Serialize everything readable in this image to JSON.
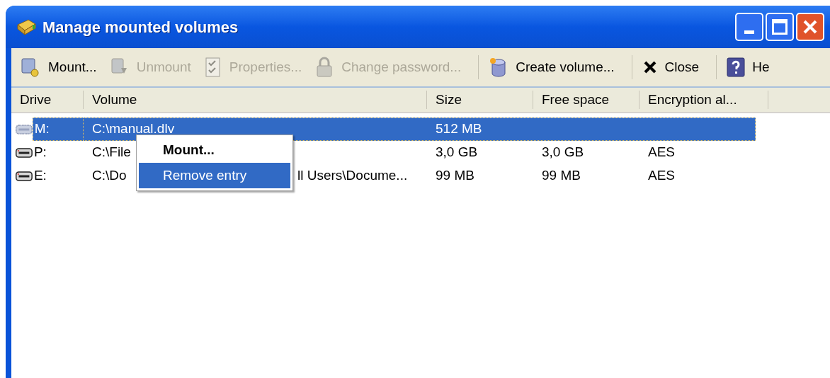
{
  "window": {
    "title": "Manage mounted volumes"
  },
  "toolbar": [
    {
      "kind": "mount",
      "label": "Mount...",
      "disabled": false
    },
    {
      "kind": "unmount",
      "label": "Unmount",
      "disabled": true
    },
    {
      "kind": "properties",
      "label": "Properties...",
      "disabled": true
    },
    {
      "kind": "password",
      "label": "Change password...",
      "disabled": true
    },
    {
      "kind": "separator"
    },
    {
      "kind": "create",
      "label": "Create volume...",
      "disabled": false
    },
    {
      "kind": "separator"
    },
    {
      "kind": "close",
      "label": "Close",
      "disabled": false
    },
    {
      "kind": "separator"
    },
    {
      "kind": "help",
      "label": "He",
      "disabled": false
    }
  ],
  "table": {
    "columns": [
      "Drive",
      "Volume",
      "Size",
      "Free space",
      "Encryption al..."
    ],
    "rows": [
      {
        "drive": "M:",
        "volume": "C:\\manual.dlv",
        "size": "512 MB",
        "free": "",
        "algorithm": "",
        "mounted": false,
        "selected": true
      },
      {
        "drive": "P:",
        "volume": "C:\\File",
        "size": "3,0 GB",
        "free": "3,0 GB",
        "algorithm": "AES",
        "mounted": true,
        "selected": false
      },
      {
        "drive": "E:",
        "volume": "C:\\Do",
        "volume_after_menu": "ll Users\\Docume...",
        "size": "99 MB",
        "free": "99 MB",
        "algorithm": "AES",
        "mounted": true,
        "selected": false
      }
    ]
  },
  "context_menu": {
    "items": [
      {
        "label": "Mount...",
        "default": true,
        "selected": false
      },
      {
        "label": "Remove entry",
        "default": false,
        "selected": true
      }
    ]
  }
}
